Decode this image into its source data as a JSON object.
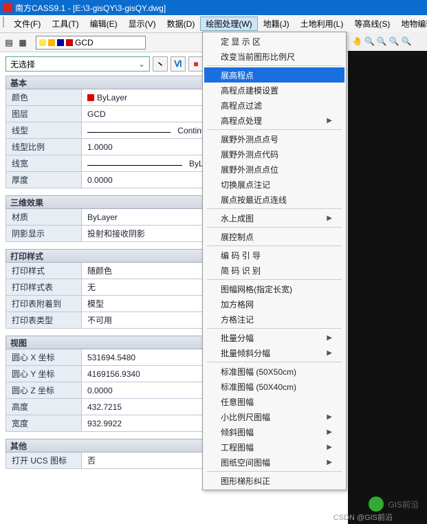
{
  "title": "南方CASS9.1 - [E:\\3-gisQY\\3-gisQY.dwg]",
  "menu": [
    "文件(F)",
    "工具(T)",
    "编辑(E)",
    "显示(V)",
    "数据(D)",
    "绘图处理(W)",
    "地籍(J)",
    "土地利用(L)",
    "等高线(S)",
    "地物编辑"
  ],
  "active_menu_index": 5,
  "layer_name": "GCD",
  "selection_combo": "无选择",
  "small_buttons": [
    "丶",
    "Ⅵ",
    "■"
  ],
  "sections": {
    "basic": {
      "title": "基本",
      "rows": [
        {
          "label": "颜色",
          "value": "ByLayer",
          "swatch": true
        },
        {
          "label": "图层",
          "value": "GCD"
        },
        {
          "label": "线型",
          "value": "Continuous",
          "line": true
        },
        {
          "label": "线型比例",
          "value": "1.0000"
        },
        {
          "label": "线宽",
          "value": "ByLayer",
          "line": true
        },
        {
          "label": "厚度",
          "value": "0.0000"
        }
      ]
    },
    "threeD": {
      "title": "三维效果",
      "rows": [
        {
          "label": "材质",
          "value": "ByLayer"
        },
        {
          "label": "阴影显示",
          "value": "投射和接收阴影"
        }
      ]
    },
    "print": {
      "title": "打印样式",
      "rows": [
        {
          "label": "打印样式",
          "value": "随颜色"
        },
        {
          "label": "打印样式表",
          "value": "无"
        },
        {
          "label": "打印表附着到",
          "value": "模型"
        },
        {
          "label": "打印表类型",
          "value": "不可用"
        }
      ]
    },
    "view": {
      "title": "视图",
      "rows": [
        {
          "label": "圆心 X 坐标",
          "value": "531694.5480"
        },
        {
          "label": "圆心 Y 坐标",
          "value": "4169156.9340"
        },
        {
          "label": "圆心 Z 坐标",
          "value": "0.0000"
        },
        {
          "label": "高度",
          "value": "432.7215"
        },
        {
          "label": "宽度",
          "value": "932.9922"
        }
      ]
    },
    "other": {
      "title": "其他",
      "rows": [
        {
          "label": "打开 UCS 图标",
          "value": "否"
        }
      ]
    }
  },
  "menu_items": [
    {
      "t": "定 显 示 区"
    },
    {
      "t": "改变当前图形比例尺"
    },
    {
      "sep": true
    },
    {
      "t": "展高程点",
      "sel": true
    },
    {
      "t": "高程点建模设置"
    },
    {
      "t": "高程点过滤"
    },
    {
      "t": "高程点处理",
      "sub": true
    },
    {
      "sep": true
    },
    {
      "t": "展野外测点点号"
    },
    {
      "t": "展野外测点代码"
    },
    {
      "t": "展野外测点点位"
    },
    {
      "t": "切换展点注记"
    },
    {
      "t": "展点按最近点连线"
    },
    {
      "sep": true
    },
    {
      "t": "水上成图",
      "sub": true
    },
    {
      "sep": true
    },
    {
      "t": "展控制点"
    },
    {
      "sep": true
    },
    {
      "t": "编 码 引 导"
    },
    {
      "t": "简 码 识 别"
    },
    {
      "sep": true
    },
    {
      "t": "图幅网格(指定长宽)"
    },
    {
      "t": "加方格网"
    },
    {
      "t": "方格注记"
    },
    {
      "sep": true
    },
    {
      "t": "批量分幅",
      "sub": true
    },
    {
      "t": "批量倾斜分幅",
      "sub": true
    },
    {
      "sep": true
    },
    {
      "t": "标准图幅 (50X50cm)"
    },
    {
      "t": "标准图幅 (50X40cm)"
    },
    {
      "t": "任意图幅"
    },
    {
      "t": "小比例尺图幅",
      "sub": true
    },
    {
      "t": "倾斜图幅",
      "sub": true
    },
    {
      "t": "工程图幅",
      "sub": true
    },
    {
      "t": "图纸空间图幅",
      "sub": true
    },
    {
      "sep": true
    },
    {
      "t": "图形梯形纠正"
    }
  ],
  "watermark": "GIS前沿",
  "watermark2": "CSDN @GIS前沿"
}
